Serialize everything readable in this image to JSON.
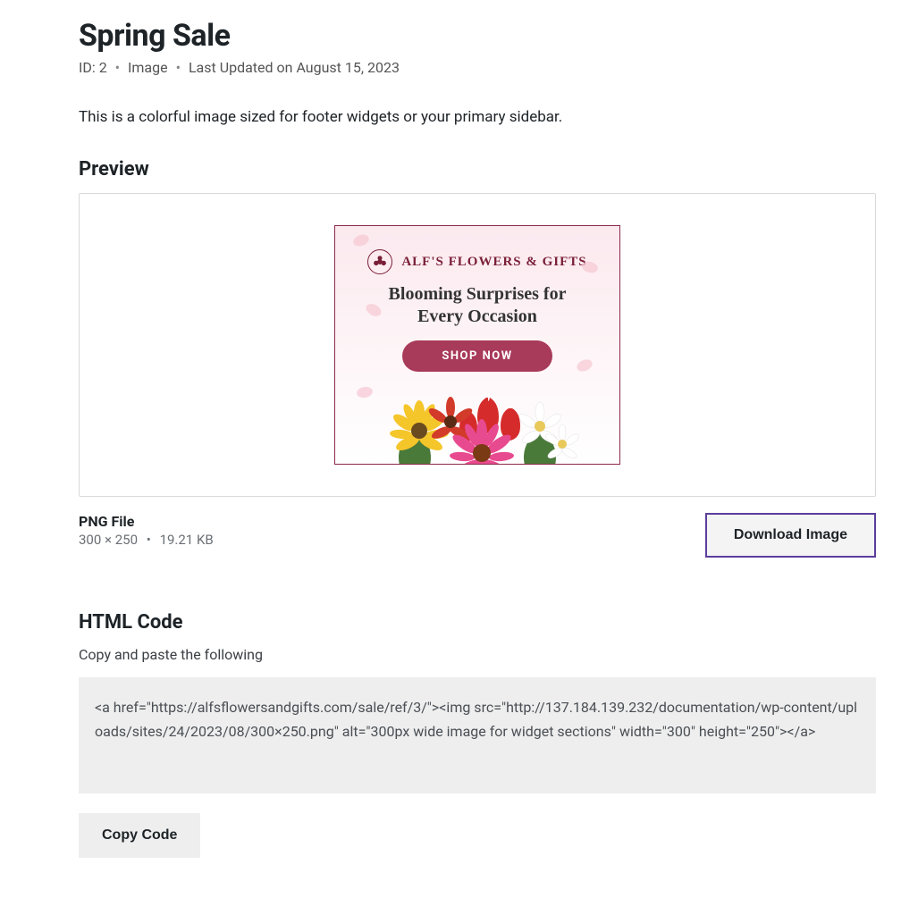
{
  "header": {
    "title": "Spring Sale",
    "id_label": "ID: 2",
    "type_label": "Image",
    "updated_label": "Last Updated on August 15, 2023"
  },
  "description": "This is a colorful image sized for footer widgets or your primary sidebar.",
  "preview": {
    "heading": "Preview",
    "ad": {
      "brand": "ALF'S FLOWERS & GIFTS",
      "headline_line1": "Blooming Surprises for",
      "headline_line2": "Every Occasion",
      "cta": "SHOP NOW"
    }
  },
  "file": {
    "label": "PNG File",
    "dimensions": "300 × 250",
    "size": "19.21 KB",
    "download_label": "Download Image"
  },
  "html_section": {
    "heading": "HTML Code",
    "subheading": "Copy and paste the following",
    "code": "<a href=\"https://alfsflowersandgifts.com/sale/ref/3/\"><img src=\"http://137.184.139.232/documentation/wp-content/uploads/sites/24/2023/08/300×250.png\" alt=\"300px wide image for widget sections\" width=\"300\" height=\"250\"></a>",
    "copy_label": "Copy Code"
  }
}
